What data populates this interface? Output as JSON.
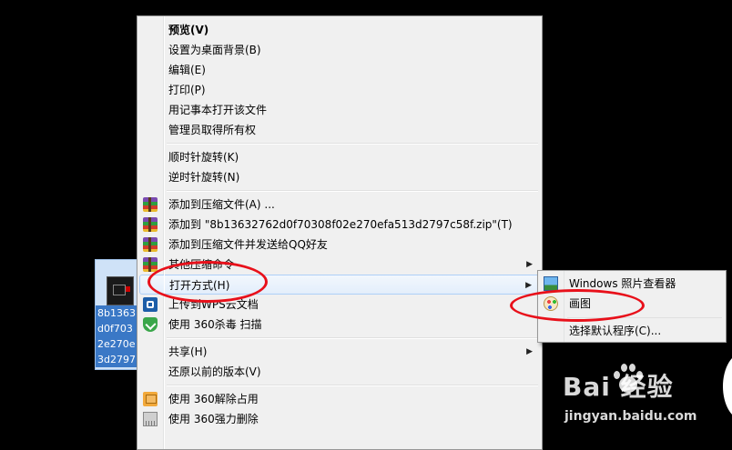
{
  "desktop_file": {
    "name": "8b1363\nd0f703\n2e270e\n3d2797"
  },
  "menu": {
    "groups": [
      [
        {
          "label": "预览(V)",
          "bold": true
        },
        {
          "label": "设置为桌面背景(B)"
        },
        {
          "label": "编辑(E)"
        },
        {
          "label": "打印(P)"
        },
        {
          "label": "用记事本打开该文件"
        },
        {
          "label": "管理员取得所有权"
        }
      ],
      [
        {
          "label": "顺时针旋转(K)"
        },
        {
          "label": "逆时针旋转(N)"
        }
      ],
      [
        {
          "label": "添加到压缩文件(A) ...",
          "icon": "winrar-icon"
        },
        {
          "label": "添加到 \"8b13632762d0f70308f02e270efa513d2797c58f.zip\"(T)",
          "icon": "winrar-icon"
        },
        {
          "label": "添加到压缩文件并发送给QQ好友",
          "icon": "winrar-icon"
        },
        {
          "label": "其他压缩命令",
          "icon": "winrar-icon",
          "submenu": true
        },
        {
          "label": "打开方式(H)",
          "submenu": true,
          "highlighted": true
        },
        {
          "label": "上传到WPS云文档",
          "icon": "wps-cloud-icon"
        },
        {
          "label": "使用 360杀毒 扫描",
          "icon": "360-shield-icon"
        }
      ],
      [
        {
          "label": "共享(H)",
          "submenu": true
        },
        {
          "label": "还原以前的版本(V)"
        }
      ],
      [
        {
          "label": "使用 360解除占用",
          "icon": "unlock-icon"
        },
        {
          "label": "使用 360强力删除",
          "icon": "shredder-icon"
        }
      ]
    ]
  },
  "submenu": {
    "items": [
      {
        "label": "Windows 照片查看器",
        "icon": "photo-viewer-icon"
      },
      {
        "label": "画图",
        "icon": "paint-icon"
      },
      {
        "label": "选择默认程序(C)..."
      }
    ]
  },
  "watermark": {
    "logo": "Bai  经验",
    "url": "jingyan.baidu.com"
  },
  "colors": {
    "annotation": "#e8101a",
    "menu_bg": "#f0f0f0",
    "hover_border": "#aecff7"
  }
}
